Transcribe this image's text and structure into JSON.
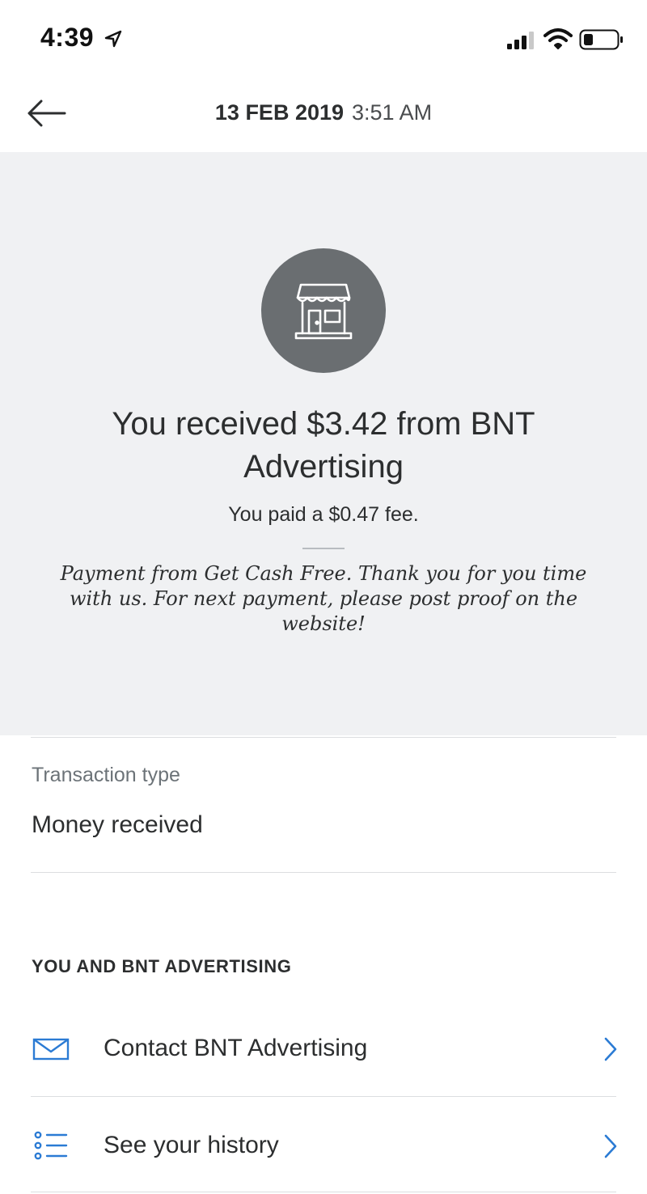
{
  "status_bar": {
    "time": "4:39",
    "icons": [
      "location-arrow-icon",
      "cellular-signal-icon",
      "wifi-icon",
      "battery-icon"
    ]
  },
  "header": {
    "date": "13 FEB 2019",
    "time": "3:51 AM",
    "back_icon": "back-arrow-icon"
  },
  "hero": {
    "avatar_icon": "storefront-icon",
    "headline": "You received $3.42 from BNT Advertising",
    "fee": "You paid a $0.47 fee.",
    "note": "Payment from Get Cash Free. Thank you for you time with us. For next payment, please post proof on the website!"
  },
  "details": {
    "transaction_type_label": "Transaction type",
    "transaction_type_value": "Money received"
  },
  "section": {
    "title": "YOU AND BNT ADVERTISING",
    "items": [
      {
        "label": "Contact BNT Advertising",
        "icon": "envelope-icon"
      },
      {
        "label": "See your history",
        "icon": "list-icon"
      }
    ]
  },
  "colors": {
    "hero_background": "#f0f1f3",
    "avatar_background": "#6a6e71",
    "accent_blue": "#2b7bd4",
    "text": "#2c2e2f",
    "muted_text": "#6c7378"
  }
}
